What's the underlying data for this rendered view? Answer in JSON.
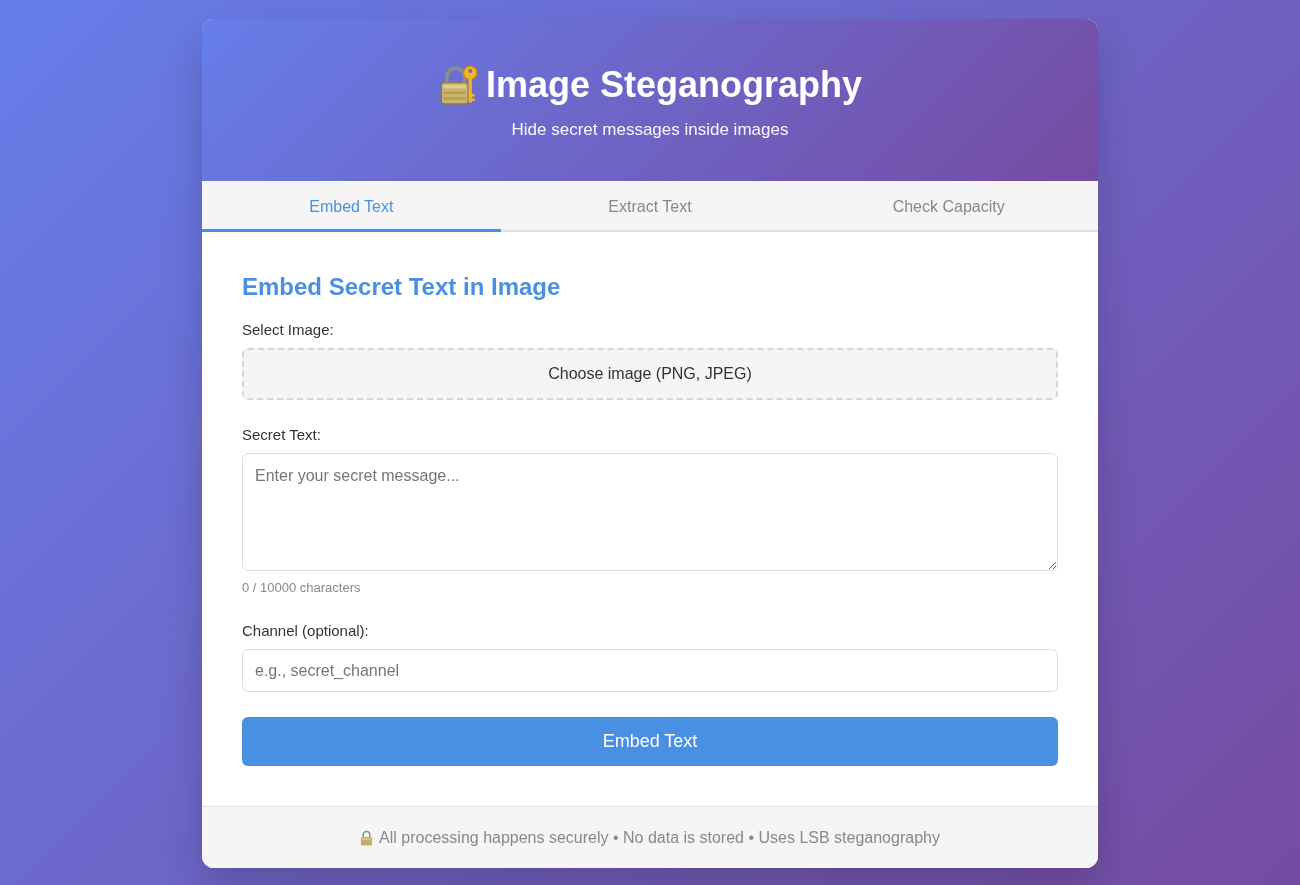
{
  "header": {
    "title": "Image Steganography",
    "subtitle": "Hide secret messages inside images"
  },
  "tabs": [
    {
      "label": "Embed Text",
      "selected": true
    },
    {
      "label": "Extract Text",
      "selected": false
    },
    {
      "label": "Check Capacity",
      "selected": false
    }
  ],
  "form": {
    "heading": "Embed Secret Text in Image",
    "fields": [
      {
        "kind": "file",
        "label": "Select Image:",
        "button": "Choose image (PNG, JPEG)"
      },
      {
        "kind": "textarea",
        "label": "Secret Text:",
        "placeholder": "Enter your secret message...",
        "hint": "0 / 10000 characters"
      },
      {
        "kind": "input",
        "label": "Channel (optional):",
        "placeholder": "e.g., secret_channel"
      }
    ],
    "submit": "Embed Text"
  },
  "footer": {
    "text": "All processing happens securely • No data is stored • Uses LSB steganography"
  }
}
